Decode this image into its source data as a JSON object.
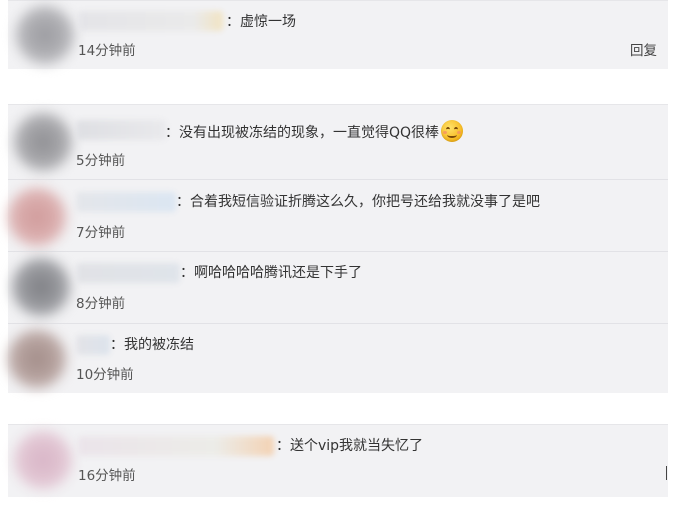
{
  "panels": [
    {
      "comments": [
        {
          "text": "：虚惊一场",
          "time": "14分钟前",
          "reply": "回复"
        }
      ]
    },
    {
      "comments": [
        {
          "text": "：没有出现被冻结的现象，一直觉得QQ很棒",
          "emoji": "smile-emoji",
          "time": "5分钟前"
        },
        {
          "text": "：合着我短信验证折腾这么久，你把号还给我就没事了是吧",
          "time": "7分钟前"
        },
        {
          "text": "：啊哈哈哈哈腾讯还是下手了",
          "time": "8分钟前"
        },
        {
          "text": "：我的被冻结",
          "time": "10分钟前"
        }
      ]
    },
    {
      "comments": [
        {
          "text": "：送个vip我就当失忆了",
          "time": "16分钟前"
        }
      ]
    }
  ],
  "colors": {
    "panel_bg": "#f2f2f4",
    "text": "#333333",
    "time": "#555555"
  }
}
